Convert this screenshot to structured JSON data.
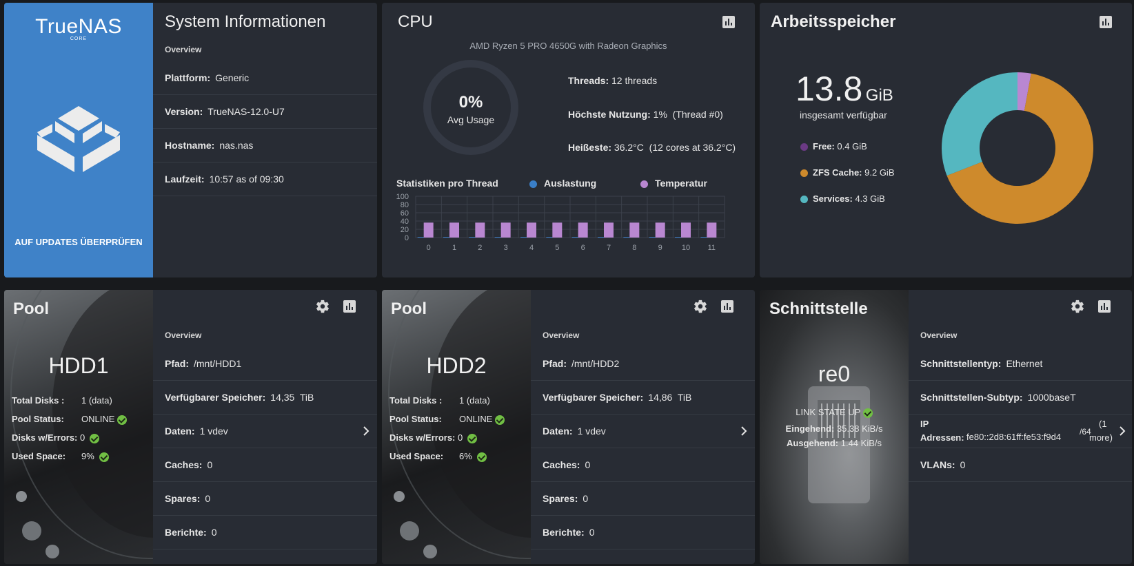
{
  "sysinfo": {
    "logo": "TrueNAS",
    "logo_sub": "CORE",
    "update_button": "AUF UPDATES ÜBERPRÜFEN",
    "title": "System Informationen",
    "overview": "Overview",
    "rows": [
      {
        "label": "Plattform:",
        "value": "Generic"
      },
      {
        "label": "Version:",
        "value": "TrueNAS-12.0-U7"
      },
      {
        "label": "Hostname:",
        "value": "nas.nas"
      },
      {
        "label": "Laufzeit:",
        "value": "10:57 as of 09:30"
      }
    ]
  },
  "cpu": {
    "title": "CPU",
    "model": "AMD Ryzen 5 PRO 4650G with Radeon Graphics",
    "usage_value": "0%",
    "usage_label": "Avg Usage",
    "threads_label": "Threads:",
    "threads_value": "12 threads",
    "max_label": "Höchste Nutzung:",
    "max_value": "1%  (Thread #0)",
    "hottest_label": "Heißeste:",
    "hottest_value": "36.2°C  (12 cores at 36.2°C)",
    "stats_title": "Statistiken pro Thread",
    "legend_usage": "Auslastung",
    "legend_temp": "Temperatur",
    "color_usage": "#3a7fc8",
    "color_temp": "#b987d1"
  },
  "memory": {
    "title": "Arbeitsspeicher",
    "total_value": "13.8",
    "total_unit": "GiB",
    "total_label": "insgesamt verfügbar",
    "legend": [
      {
        "label": "Free:",
        "value": "0.4 GiB",
        "color": "#6b3a84"
      },
      {
        "label": "ZFS Cache:",
        "value": "9.2 GiB",
        "color": "#ce8a2c"
      },
      {
        "label": "Services:",
        "value": "4.3 GiB",
        "color": "#55b7c0"
      }
    ],
    "donut": [
      {
        "name": "Free",
        "value": 0.4,
        "color": "#b987d1"
      },
      {
        "name": "ZFS Cache",
        "value": 9.2,
        "color": "#ce8a2c"
      },
      {
        "name": "Services",
        "value": 4.3,
        "color": "#55b7c0"
      }
    ]
  },
  "chart_data": {
    "type": "bar",
    "categories": [
      "0",
      "1",
      "2",
      "3",
      "4",
      "5",
      "6",
      "7",
      "8",
      "9",
      "10",
      "11"
    ],
    "series": [
      {
        "name": "Auslastung",
        "values": [
          1,
          0,
          0,
          0,
          0,
          0,
          0,
          0,
          0,
          0,
          0,
          0
        ]
      },
      {
        "name": "Temperatur",
        "values": [
          36.2,
          36.2,
          36.2,
          36.2,
          36.2,
          36.2,
          36.2,
          36.2,
          36.2,
          36.2,
          36.2,
          36.2
        ]
      }
    ],
    "yticks": [
      "0",
      "20",
      "40",
      "60",
      "80",
      "100"
    ],
    "ylim": [
      0,
      100
    ],
    "grid": true
  },
  "pools": [
    {
      "title": "Pool",
      "name": "HDD1",
      "total_disks_label": "Total Disks :",
      "total_disks_value": "1 (data)",
      "status_label": "Pool Status:",
      "status_value": "ONLINE",
      "errors_label": "Disks w/Errors:",
      "errors_value": "0",
      "used_label": "Used Space:",
      "used_value": "9%",
      "overview": "Overview",
      "rows": [
        {
          "label": "Pfad:",
          "value": "/mnt/HDD1"
        },
        {
          "label": "Verfügbarer Speicher:",
          "value": "14,35  TiB"
        },
        {
          "label": "Daten:",
          "value": "1 vdev"
        },
        {
          "label": "Caches:",
          "value": "0"
        },
        {
          "label": "Spares:",
          "value": "0"
        },
        {
          "label": "Berichte:",
          "value": "0"
        }
      ]
    },
    {
      "title": "Pool",
      "name": "HDD2",
      "total_disks_label": "Total Disks :",
      "total_disks_value": "1 (data)",
      "status_label": "Pool Status:",
      "status_value": "ONLINE",
      "errors_label": "Disks w/Errors:",
      "errors_value": "0",
      "used_label": "Used Space:",
      "used_value": "6%",
      "overview": "Overview",
      "rows": [
        {
          "label": "Pfad:",
          "value": "/mnt/HDD2"
        },
        {
          "label": "Verfügbarer Speicher:",
          "value": "14,86  TiB"
        },
        {
          "label": "Daten:",
          "value": "1 vdev"
        },
        {
          "label": "Caches:",
          "value": "0"
        },
        {
          "label": "Spares:",
          "value": "0"
        },
        {
          "label": "Berichte:",
          "value": "0"
        }
      ]
    }
  ],
  "nic": {
    "title": "Schnittstelle",
    "name": "re0",
    "link_state": "LINK STATE UP",
    "in_label": "Eingehend:",
    "in_value": "35.38 KiB/s",
    "out_label": "Ausgehend:",
    "out_value": "1.44 KiB/s",
    "overview": "Overview",
    "type_label": "Schnittstellentyp:",
    "type_value": "Ethernet",
    "subtype_label": "Schnittstellen-Subtyp:",
    "subtype_value": "1000baseT",
    "ip_label_1": "IP",
    "ip_label_2": "Adressen:",
    "ip_value": "fe80::2d8:61ff:fe53:f9d4",
    "ip_prefix": "/64",
    "ip_more_1": "(1",
    "ip_more_2": "more)",
    "vlans_label": "VLANs:",
    "vlans_value": "0"
  }
}
